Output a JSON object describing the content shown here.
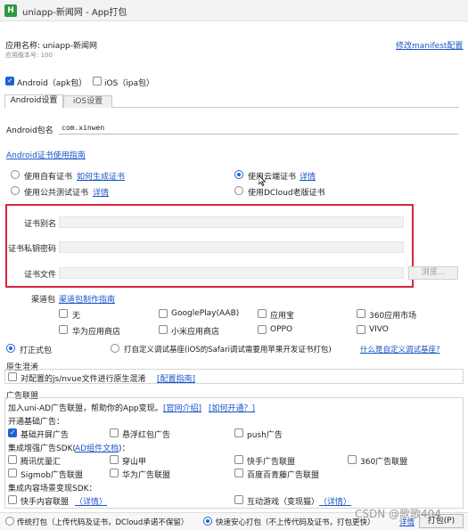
{
  "window": {
    "title": "uniapp-新闻网 - App打包"
  },
  "header": {
    "app_name_label": "应用名称: uniapp-新闻网",
    "version_label": "应用版本号: 100",
    "modify_manifest_link": "修改manifest配置"
  },
  "platforms": {
    "android_label": "Android（apk包）",
    "ios_label": "iOS（ipa包）"
  },
  "tabs": {
    "android": "Android设置",
    "ios": "iOS设置"
  },
  "android": {
    "package_label": "Android包名",
    "package_value": "com.xinwen",
    "cert_guide_link": "Android证书使用指南",
    "cert_options": {
      "own_cert": "使用自有证书",
      "how_to_generate_link": "如何生成证书",
      "cloud_cert": "使用云端证书",
      "cloud_detail_link": "详情",
      "public_test_cert": "使用公共测试证书",
      "public_detail_link": "详情",
      "dcloud_old_cert": "使用DCloud老版证书"
    },
    "cert_fields": {
      "alias_label": "证书别名",
      "password_label": "证书私钥密码",
      "file_label": "证书文件",
      "browse_button": "浏览..."
    },
    "channels": {
      "label": "渠道包",
      "guide_link": "渠道包制作指南",
      "items": [
        "无",
        "GooglePlay(AAB)",
        "应用宝",
        "360应用市场",
        "华为应用商店",
        "小米应用商店",
        "OPPO",
        "VIVO"
      ]
    }
  },
  "pack_type": {
    "formal": "打正式包",
    "custom_base": "打自定义调试基座(iOS的Safari调试需要用苹果开发证书打包)",
    "what_is_custom_link": "什么是自定义调试基座?"
  },
  "native_obfuscation": {
    "title": "原生混淆",
    "checkbox_label": "对配置的js/nvue文件进行原生混淆",
    "config_link": "[配置指南]"
  },
  "ads": {
    "title": "广告联盟",
    "intro_text": "加入uni-AD广告联盟，帮助你的App变现。",
    "official_intro_link": "[官网介绍]",
    "how_to_enable_link": "[如何开通？]",
    "basic_label": "开通基础广告：",
    "basic_items": [
      "基础开屏广告",
      "悬浮红包广告",
      "push广告"
    ],
    "enhanced_label_prefix": "集成增强广告SDK(",
    "enhanced_docs_link": "AD组件文档",
    "enhanced_label_suffix": ")：",
    "enhanced_items": [
      "腾讯优量汇",
      "穿山甲",
      "快手广告联盟",
      "360广告联盟",
      "Sigmob广告联盟",
      "华为广告联盟",
      "百度百青藤广告联盟"
    ],
    "content_label": "集成内容场景变现SDK：",
    "content_items": [
      "快手内容联盟",
      "互动游戏（变现猫）"
    ],
    "content_detail_link_1": "（详情）",
    "content_detail_link_2": "（详情）"
  },
  "bottom": {
    "traditional": "传统打包（上传代码及证书，DCloud承诺不保留）",
    "fast_safe": "快速安心打包（不上传代码及证书，打包更快）",
    "detail_link": "详情",
    "pack_button": "打包(P)"
  },
  "watermark": "CSDN @歌歌404"
}
